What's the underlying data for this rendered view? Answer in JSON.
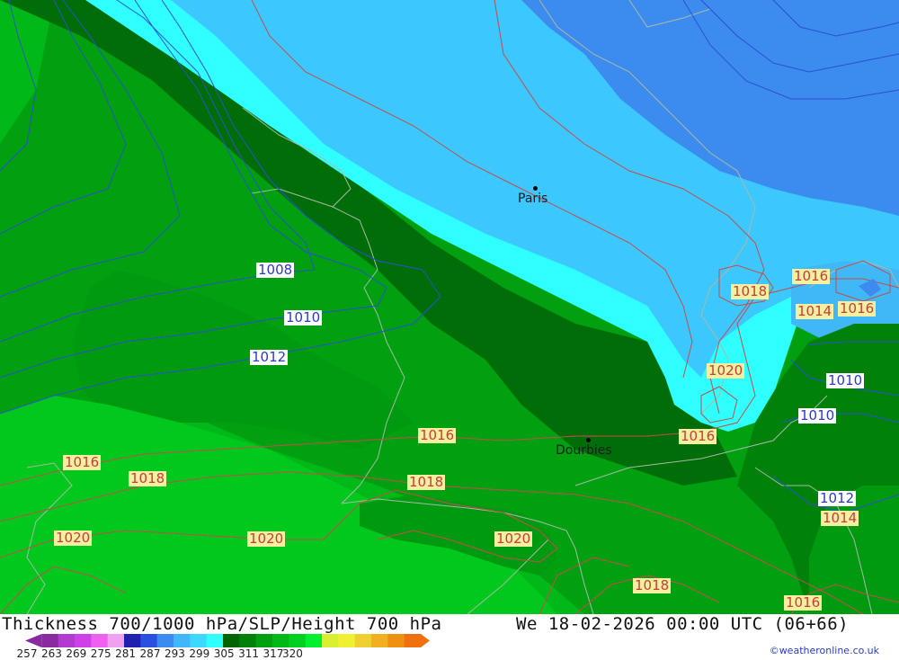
{
  "map": {
    "cities": [
      {
        "name": "Paris"
      },
      {
        "name": "Dourbies"
      }
    ],
    "isobar_labels": [
      {
        "text": "1008",
        "color": "blue"
      },
      {
        "text": "1010",
        "color": "blue"
      },
      {
        "text": "1012",
        "color": "blue"
      },
      {
        "text": "1016",
        "color": "red"
      },
      {
        "text": "1018",
        "color": "red"
      },
      {
        "text": "1020",
        "color": "red"
      },
      {
        "text": "1016",
        "color": "red"
      },
      {
        "text": "1018",
        "color": "red"
      },
      {
        "text": "1020",
        "color": "red"
      },
      {
        "text": "1016",
        "color": "red"
      },
      {
        "text": "1018",
        "color": "red"
      },
      {
        "text": "1020",
        "color": "red"
      },
      {
        "text": "1018",
        "color": "red"
      },
      {
        "text": "1016",
        "color": "red"
      },
      {
        "text": "1018",
        "color": "red"
      },
      {
        "text": "1016",
        "color": "red"
      },
      {
        "text": "1014",
        "color": "red"
      },
      {
        "text": "1016",
        "color": "red"
      },
      {
        "text": "1020",
        "color": "red"
      },
      {
        "text": "1016",
        "color": "red"
      },
      {
        "text": "1010",
        "color": "blue"
      },
      {
        "text": "1010",
        "color": "blue"
      },
      {
        "text": "1012",
        "color": "blue"
      },
      {
        "text": "1014",
        "color": "red"
      },
      {
        "text": "1016",
        "color": "red"
      }
    ]
  },
  "footer": {
    "title": "Thickness 700/1000 hPa/SLP/Height 700 hPa",
    "datetime": "We 18-02-2026 00:00 UTC (06+66)",
    "credit": "©weatheronline.co.uk",
    "scale": {
      "colors": [
        "#8a2aa0",
        "#b23ad0",
        "#d040e8",
        "#f060f0",
        "#f0a0f0",
        "#2020b0",
        "#2a50e0",
        "#3c8cf0",
        "#40b8f8",
        "#3cd8ff",
        "#30ffff",
        "#006400",
        "#00820a",
        "#00a010",
        "#00b818",
        "#00d020",
        "#00f030",
        "#d8f030",
        "#f0f030",
        "#f0d030",
        "#f0b020",
        "#f09010",
        "#f07010"
      ],
      "ticks": [
        "257",
        "263",
        "269",
        "275",
        "281",
        "287",
        "293",
        "299",
        "305",
        "311",
        "317",
        "320"
      ]
    }
  }
}
